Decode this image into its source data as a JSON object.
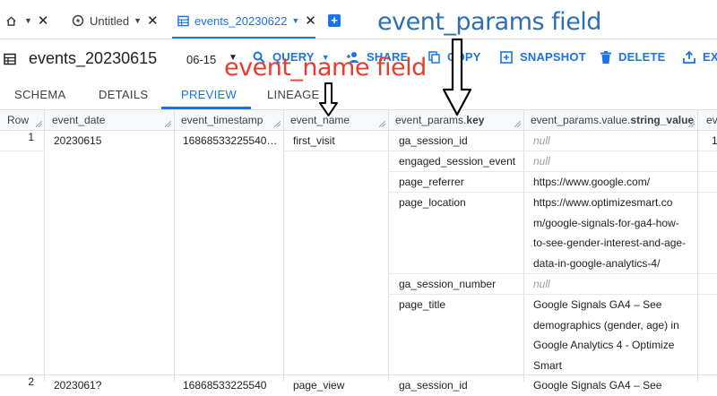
{
  "tabs": [
    {
      "label": "",
      "icon": "home-icon",
      "active": false
    },
    {
      "label": "Untitled",
      "icon": "query-icon",
      "active": false
    },
    {
      "label": "events_20230622",
      "icon": "table-icon",
      "active": true
    }
  ],
  "toolbar": {
    "table_name": "events_20230615",
    "date_suffix": "06-15",
    "query_label": "QUERY",
    "share_label": "SHARE",
    "copy_label": "COPY",
    "snapshot_label": "SNAPSHOT",
    "delete_label": "DELETE",
    "export_label": "EXP"
  },
  "subtabs": [
    "SCHEMA",
    "DETAILS",
    "PREVIEW",
    "LINEAGE"
  ],
  "active_subtab": "PREVIEW",
  "columns": {
    "row": "Row",
    "event_date": "event_date",
    "event_timestamp": "event_timestamp",
    "event_name": "event_name",
    "params_key_prefix": "event_params.",
    "params_key_bold": "key",
    "params_value_prefix": "event_params.value.",
    "params_value_bold": "string_value",
    "next": "ev"
  },
  "row1": {
    "row": "1",
    "event_date": "20230615",
    "event_timestamp": "16868533225540…",
    "event_name": "first_visit",
    "extra": "1"
  },
  "params": [
    {
      "key": "ga_session_id",
      "value": "null",
      "null": true
    },
    {
      "key": "engaged_session_event",
      "value": "null",
      "null": true
    },
    {
      "key": "page_referrer",
      "value": "https://www.google.com/"
    },
    {
      "key": "page_location",
      "value_lines": [
        "https://www.optimizesmart.co",
        "m/google-signals-for-ga4-how-",
        "to-see-gender-interest-and-age-",
        "data-in-google-analytics-4/"
      ]
    },
    {
      "key": "ga_session_number",
      "value": "null",
      "null": true
    },
    {
      "key": "page_title",
      "value_lines": [
        "Google Signals GA4 – See",
        "demographics (gender, age) in",
        "Google Analytics 4 - Optimize",
        "Smart"
      ]
    }
  ],
  "row2": {
    "row": "2",
    "event_date": "2023061?",
    "event_timestamp": "16868533225540",
    "event_name": "page_view",
    "key": "ga_session_id",
    "value": "Google Signals GA4 – See"
  },
  "annotations": {
    "event_params": "event_params field",
    "event_name": "event_name field"
  },
  "colors": {
    "accent": "#1a73e8",
    "annotation_blue": "#2e6fad",
    "annotation_red": "#ea3b2e",
    "null_text": "#9aa0a6"
  }
}
